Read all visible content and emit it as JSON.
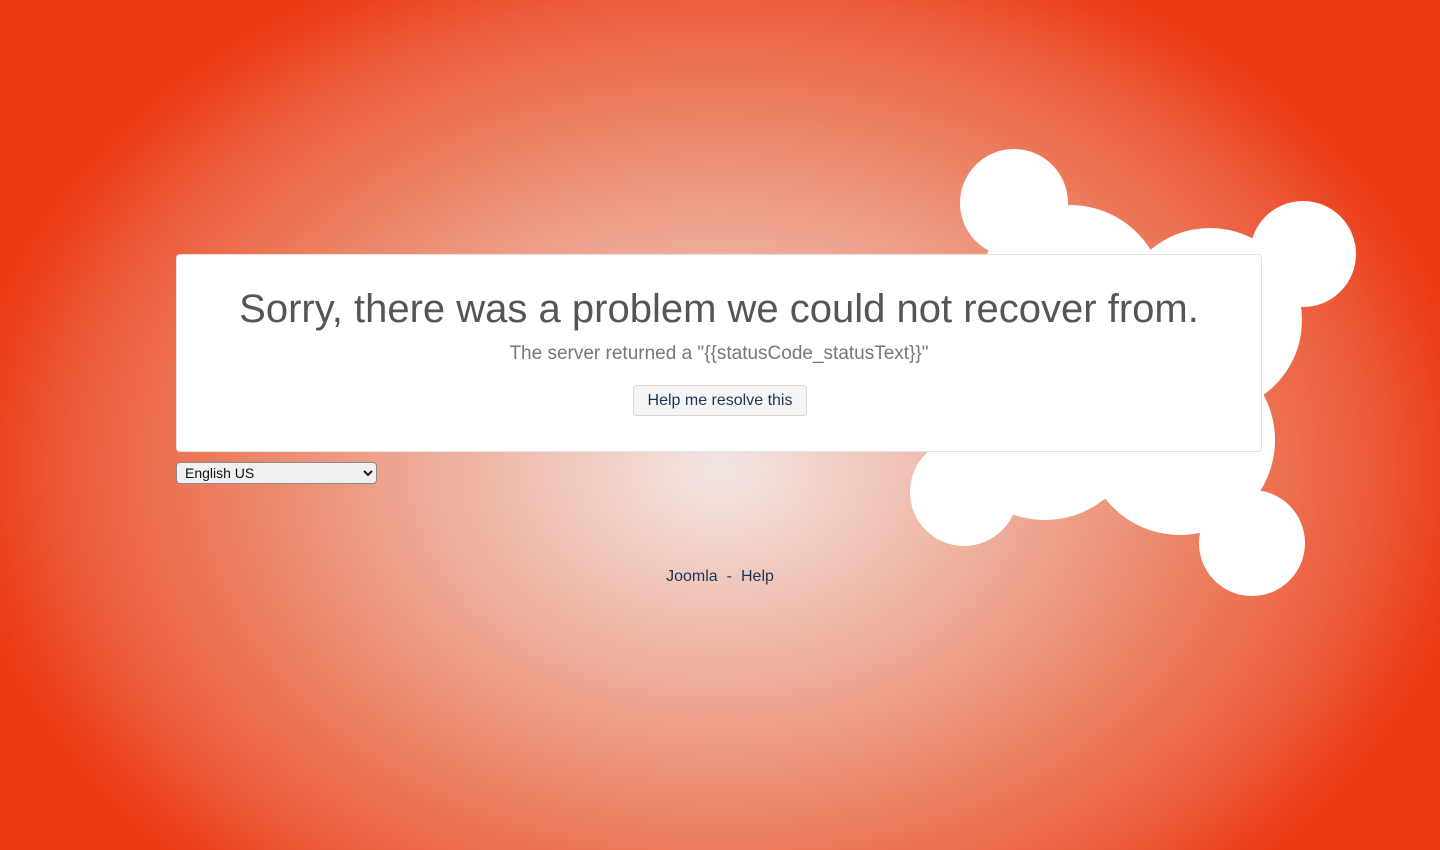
{
  "error": {
    "title": "Sorry, there was a problem we could not recover from.",
    "message": "The server returned a \"{{statusCode_statusText}}\"",
    "help_button_label": "Help me resolve this"
  },
  "language": {
    "selected": "English US",
    "options": [
      "English US"
    ]
  },
  "footer": {
    "links": [
      {
        "label": "Joomla"
      },
      {
        "label": "Help"
      }
    ],
    "separator": "-"
  },
  "colors": {
    "background_edge": "#ec3812",
    "background_center": "#f2e6e3",
    "link": "#1b3559",
    "title_text": "#555555"
  },
  "icons": {
    "background_logo": "joomla-logo"
  }
}
